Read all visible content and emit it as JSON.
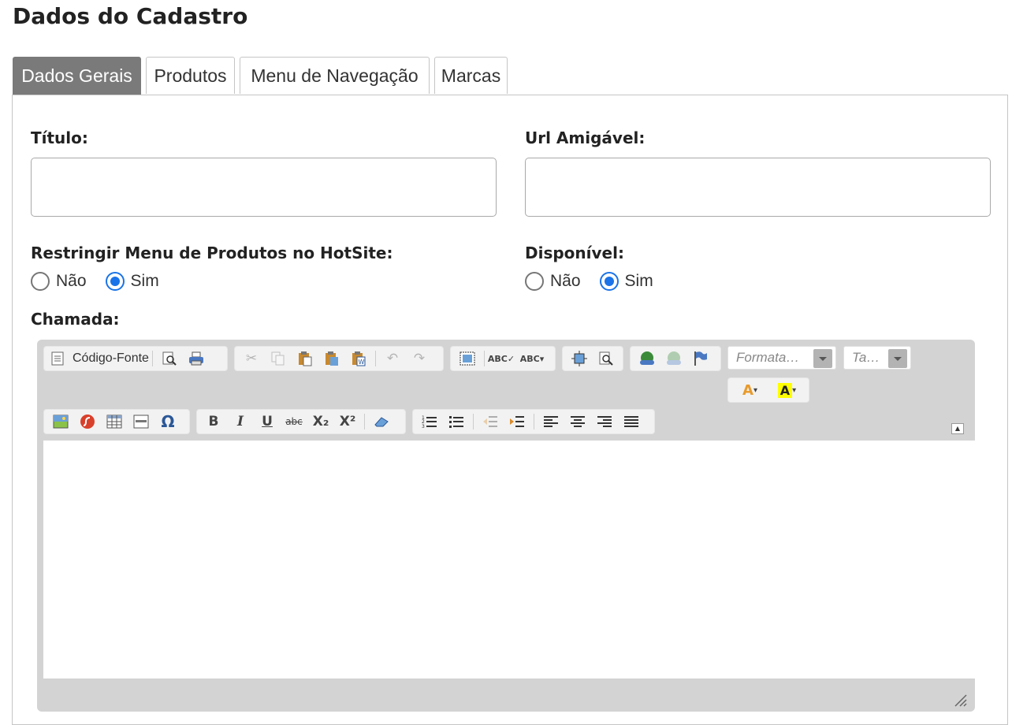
{
  "page_title": "Dados do Cadastro",
  "tabs": [
    {
      "label": "Dados Gerais",
      "active": true
    },
    {
      "label": "Produtos",
      "active": false
    },
    {
      "label": "Menu de Navegação",
      "active": false
    },
    {
      "label": "Marcas",
      "active": false
    }
  ],
  "form": {
    "titulo_label": "Título:",
    "titulo_value": "",
    "url_label": "Url Amigável:",
    "url_value": "",
    "restringir_label": "Restringir Menu de Produtos no HotSite:",
    "restringir_options": [
      "Não",
      "Sim"
    ],
    "restringir_selected": "Sim",
    "disponivel_label": "Disponível:",
    "disponivel_options": [
      "Não",
      "Sim"
    ],
    "disponivel_selected": "Sim",
    "chamada_label": "Chamada:"
  },
  "editor": {
    "source_label": "Código-Fonte",
    "format_placeholder": "Formata…",
    "size_placeholder": "Ta…",
    "bold_label": "B",
    "italic_label": "I",
    "underline_label": "U",
    "strike_label": "abc",
    "subscript_label": "X₂",
    "superscript_label": "X²",
    "text_color_label": "A",
    "bg_color_label": "A",
    "omega_label": "Ω",
    "accent_colors": {
      "primary": "#1a73e8",
      "tab_active": "#7a7a7a"
    }
  }
}
